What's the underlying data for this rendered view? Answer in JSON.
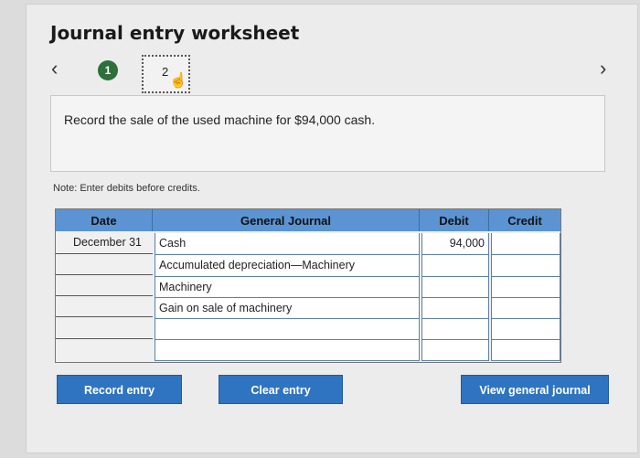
{
  "title": "Journal entry worksheet",
  "nav": {
    "prev_icon": "‹",
    "next_icon": "›"
  },
  "steps": [
    {
      "label": "1",
      "status": "completed"
    },
    {
      "label": "2",
      "status": "current"
    }
  ],
  "instruction": "Record the sale of the used machine for $94,000 cash.",
  "note": "Note: Enter debits before credits.",
  "journal": {
    "headers": {
      "date": "Date",
      "account": "General Journal",
      "debit": "Debit",
      "credit": "Credit"
    },
    "rows": [
      {
        "date": "December 31",
        "account": "Cash",
        "debit": "94,000",
        "credit": ""
      },
      {
        "date": "",
        "account": "Accumulated depreciation—Machinery",
        "debit": "",
        "credit": ""
      },
      {
        "date": "",
        "account": "Machinery",
        "debit": "",
        "credit": ""
      },
      {
        "date": "",
        "account": "Gain on sale of machinery",
        "debit": "",
        "credit": ""
      },
      {
        "date": "",
        "account": "",
        "debit": "",
        "credit": ""
      },
      {
        "date": "",
        "account": "",
        "debit": "",
        "credit": ""
      }
    ]
  },
  "buttons": {
    "record": "Record entry",
    "clear": "Clear entry",
    "view": "View general journal"
  },
  "colors": {
    "header_blue": "#5b93d3",
    "button_blue": "#2f74c0",
    "step_green": "#2e6f3b"
  }
}
